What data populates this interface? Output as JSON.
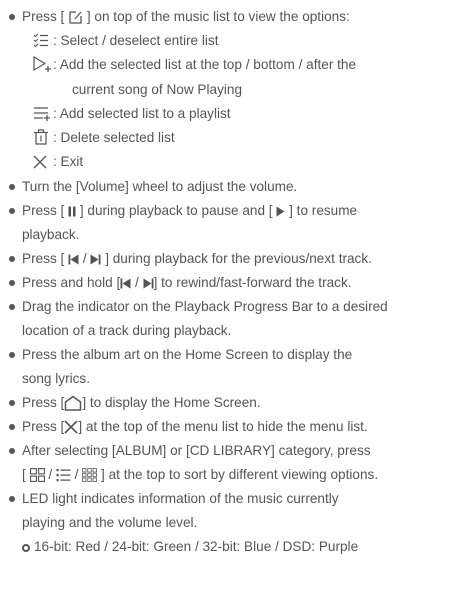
{
  "items": [
    {
      "pre": "Press [ ",
      "post": " ] on top of the music list to view the options:"
    },
    {
      "text": "Turn the [Volume] wheel to adjust the volume."
    },
    {
      "pre": "Press [ ",
      "post": " ] during playback to pause and [ ",
      "post2": " ] to resume",
      "cont": "playback."
    },
    {
      "pre": "Press [ ",
      "post": " ] during playback for the previous/next track."
    },
    {
      "pre": "Press and hold [",
      "post": "] to rewind/fast-forward the track."
    },
    {
      "text": "Drag the indicator on the Playback Progress Bar to a desired",
      "cont": "location of a track during playback."
    },
    {
      "text": "Press the album art on the Home Screen to display the",
      "cont": "song lyrics."
    },
    {
      "pre": "Press [",
      "post": "] to display the Home Screen."
    },
    {
      "pre": "Press [",
      "post": "] at the top of the menu list to hide the menu list."
    },
    {
      "text": "After selecting [ALBUM] or [CD LIBRARY] category, press",
      "pre2": "[ ",
      "mid": " / ",
      "mid2": " / ",
      "post": " ] at the top to sort by different viewing options."
    },
    {
      "text": "LED light indicates information of the music currently",
      "cont": "playing and the volume level."
    }
  ],
  "options": [
    {
      "icon": "select-list-icon",
      "text": ": Select / deselect entire list"
    },
    {
      "icon": "add-to-now-playing-icon",
      "text": ": Add the selected list at the top / bottom / after the",
      "cont": "current song of Now Playing"
    },
    {
      "icon": "add-to-playlist-icon",
      "text": ": Add selected list to a playlist"
    },
    {
      "icon": "trash-icon",
      "text": ": Delete selected list"
    },
    {
      "icon": "close-icon",
      "text": ": Exit"
    }
  ],
  "prev_next_sep": " / ",
  "led_line": "16-bit: Red / 24-bit: Green / 32-bit: Blue / DSD: Purple",
  "colors": {
    "text": "#555555",
    "background": "#ffffff"
  }
}
